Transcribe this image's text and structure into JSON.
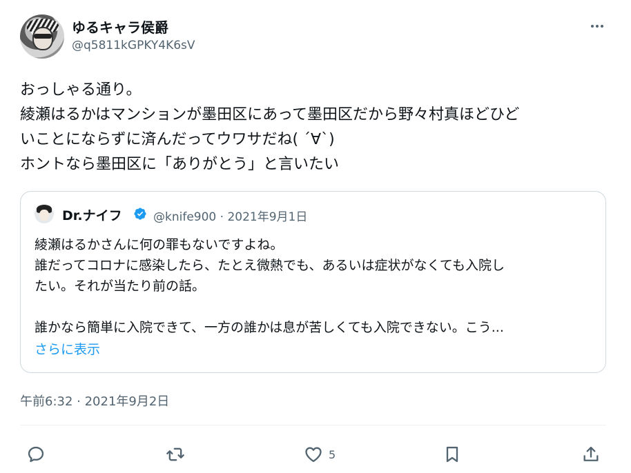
{
  "user": {
    "display_name": "ゆるキャラ侯爵",
    "handle": "@q5811kGPKY4K6sV"
  },
  "tweet": {
    "lines": [
      "おっしゃる通り。",
      "綾瀬はるかはマンションが墨田区にあって墨田区だから野々村真ほどひど",
      "いことにならずに済んだってウワサだね( ´∀`)",
      "ホントなら墨田区に「ありがとう」と言いたい"
    ],
    "timestamp": "午前6:32 · 2021年9月2日"
  },
  "quote": {
    "name": "Dr.ナイフ",
    "meta": "@knife900 · 2021年9月1日",
    "lines": [
      "綾瀬はるかさんに何の罪もないですよね。",
      "誰だってコロナに感染したら、たとえ微熱でも、あるいは症状がなくても入院し",
      "たい。それが当たり前の話。",
      "",
      "誰かなら簡単に入院できて、一方の誰かは息が苦しくても入院できない。こう..."
    ],
    "show_more": "さらに表示"
  },
  "actions": {
    "like_count": "5"
  },
  "icons": {
    "more": "more-icon",
    "verified": "verified-badge-icon",
    "reply": "reply-icon",
    "retweet": "retweet-icon",
    "like": "like-icon",
    "bookmark": "bookmark-icon",
    "share": "share-icon"
  },
  "colors": {
    "text": "#0f1419",
    "secondary": "#536471",
    "link": "#1d9bf0",
    "border": "#cfd9de"
  }
}
